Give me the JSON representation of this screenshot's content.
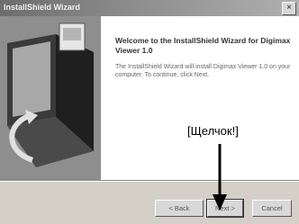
{
  "window": {
    "title": "InstallShield Wizard",
    "close_glyph": "×"
  },
  "welcome": {
    "title": "Welcome to the InstallShield Wizard for Digimax Viewer 1.0",
    "text": "The InstallShield Wizard will install Digimax Viewer 1.0 on your computer. To continue, click Next."
  },
  "annotation": {
    "label": "[Щелчок!]"
  },
  "buttons": {
    "back_label": "< Back",
    "next_label": "Next >",
    "cancel_label": "Cancel"
  },
  "icons": {
    "setup_illustration": "computer-disk-illustration",
    "arrow": "down-arrow-icon"
  }
}
